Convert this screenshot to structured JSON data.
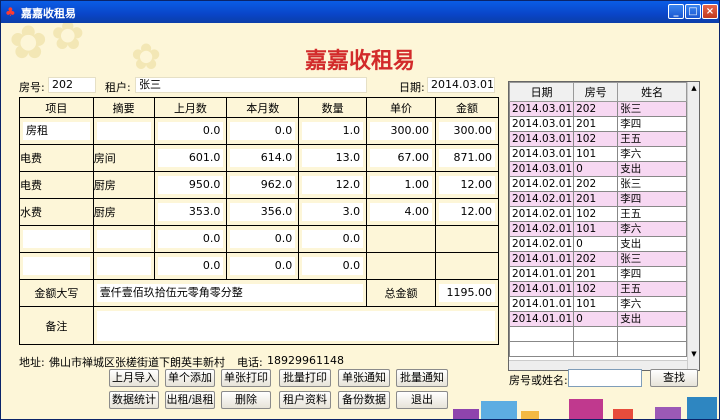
{
  "window": {
    "title": "嘉嘉收租易"
  },
  "app_title": "嘉嘉收租易",
  "room_label": "房号:",
  "room_value": "202",
  "tenant_label": "租户:",
  "tenant_value": "张三",
  "date_label": "日期:",
  "date_value": "2014.03.01",
  "grid": {
    "headers": [
      "项目",
      "摘要",
      "上月数",
      "本月数",
      "数量",
      "单价",
      "金额"
    ],
    "rows": [
      {
        "item": "房租",
        "note": "",
        "prev": "0.0",
        "curr": "0.0",
        "qty": "1.0",
        "price": "300.00",
        "amount": "300.00"
      },
      {
        "item": "电费",
        "note": "房间",
        "prev": "601.0",
        "curr": "614.0",
        "qty": "13.0",
        "price": "67.00",
        "amount": "871.00"
      },
      {
        "item": "电费",
        "note": "厨房",
        "prev": "950.0",
        "curr": "962.0",
        "qty": "12.0",
        "price": "1.00",
        "amount": "12.00"
      },
      {
        "item": "水费",
        "note": "厨房",
        "prev": "353.0",
        "curr": "356.0",
        "qty": "3.0",
        "price": "4.00",
        "amount": "12.00"
      },
      {
        "item": "",
        "note": "",
        "prev": "0.0",
        "curr": "0.0",
        "qty": "0.0",
        "price": "",
        "amount": ""
      },
      {
        "item": "",
        "note": "",
        "prev": "0.0",
        "curr": "0.0",
        "qty": "0.0",
        "price": "",
        "amount": ""
      }
    ],
    "amount_words_label": "金额大写",
    "amount_words": "壹仟壹佰玖拾伍元零角零分整",
    "total_label": "总金额",
    "total": "1195.00",
    "remark_label": "备注",
    "remark": ""
  },
  "list": {
    "headers": [
      "日期",
      "房号",
      "姓名"
    ],
    "rows": [
      [
        "2014.03.01",
        "202",
        "张三"
      ],
      [
        "2014.03.01",
        "201",
        "李四"
      ],
      [
        "2014.03.01",
        "102",
        "王五"
      ],
      [
        "2014.03.01",
        "101",
        "李六"
      ],
      [
        "2014.03.01",
        "0",
        "支出"
      ],
      [
        "2014.02.01",
        "202",
        "张三"
      ],
      [
        "2014.02.01",
        "201",
        "李四"
      ],
      [
        "2014.02.01",
        "102",
        "王五"
      ],
      [
        "2014.02.01",
        "101",
        "李六"
      ],
      [
        "2014.02.01",
        "0",
        "支出"
      ],
      [
        "2014.01.01",
        "202",
        "张三"
      ],
      [
        "2014.01.01",
        "201",
        "李四"
      ],
      [
        "2014.01.01",
        "102",
        "王五"
      ],
      [
        "2014.01.01",
        "101",
        "李六"
      ],
      [
        "2014.01.01",
        "0",
        "支出"
      ]
    ]
  },
  "footer": {
    "address_label": "地址:",
    "address": "佛山市禅城区张槎街道下朗英丰新村",
    "phone_label": "电话:",
    "phone": "18929961148"
  },
  "buttons_row1": [
    "上月导入",
    "单个添加",
    "单张打印",
    "批量打印",
    "单张通知",
    "批量通知"
  ],
  "buttons_row2": [
    "数据统计",
    "出租/退租",
    "删除",
    "租户资料",
    "备份数据",
    "退出"
  ],
  "search": {
    "label": "房号或姓名:",
    "value": "",
    "button": "查找"
  },
  "colors": {
    "background": "#fdf6d8",
    "title": "#d22b2b",
    "list_alt": "#f7d8f2",
    "titlebar": "#0a45c8"
  }
}
